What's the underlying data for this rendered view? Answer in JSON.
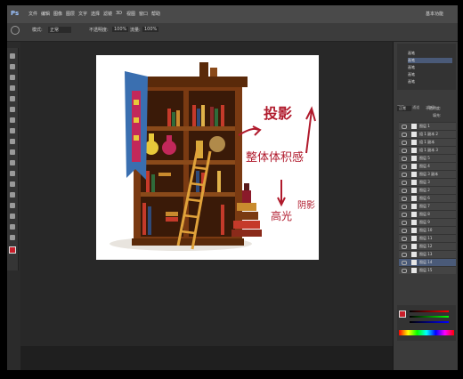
{
  "app": {
    "title_text": "Ps",
    "zoom_label": "100%",
    "mode_label": "正常",
    "opacity_label": "不透明度:",
    "opacity_value": "100%",
    "flow_label": "流量:",
    "flow_value": "100%",
    "workspace_label": "基本功能"
  },
  "menus": [
    "文件",
    "编辑",
    "图像",
    "图层",
    "文字",
    "选择",
    "滤镜",
    "3D",
    "视图",
    "窗口",
    "帮助"
  ],
  "history": {
    "items": [
      "画笔",
      "画笔",
      "画笔",
      "画笔",
      "画笔"
    ]
  },
  "layers": {
    "tabs": [
      "图层",
      "通道",
      "路径"
    ],
    "blend_mode": "正常",
    "opacity_label": "不透明度:",
    "fill_label": "填充:",
    "items": [
      "图层 1",
      "组 1 副本 2",
      "组 1 副本",
      "组 1 副本 3",
      "图层 5",
      "图层 4",
      "图层 3 副本",
      "图层 3",
      "图层 2",
      "图层 6",
      "图层 7",
      "图层 8",
      "图层 9",
      "图层 10",
      "图层 11",
      "图层 12",
      "图层 13",
      "图层 14",
      "图层 15"
    ]
  },
  "annotations": {
    "line1": "投影",
    "line2": "整体体积感",
    "line3": "高光",
    "line4": "阴影"
  },
  "colors": {
    "foreground": "#c81e2a",
    "background": "#ffffff",
    "annotation_ink": "#b01a2c"
  }
}
